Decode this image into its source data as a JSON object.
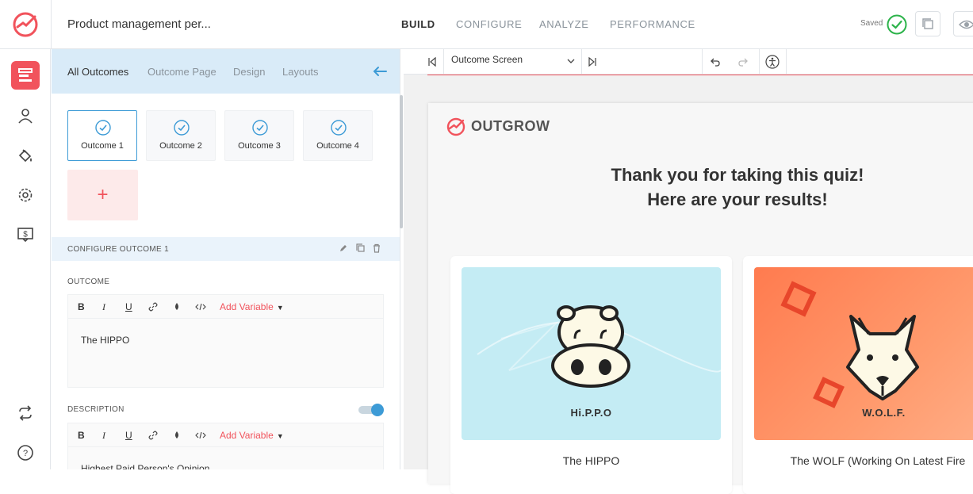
{
  "header": {
    "title": "Product management per...",
    "tabs": [
      "BUILD",
      "CONFIGURE",
      "ANALYZE",
      "PERFORMANCE"
    ],
    "active_tab": "BUILD",
    "saved_label": "Saved"
  },
  "panel": {
    "tabs": [
      "All Outcomes",
      "Outcome Page",
      "Design",
      "Layouts"
    ],
    "active_tab": "All Outcomes",
    "outcomes": [
      "Outcome 1",
      "Outcome 2",
      "Outcome 3",
      "Outcome 4"
    ],
    "add_outcome_label": "+",
    "configure_label": "CONFIGURE OUTCOME 1",
    "outcome_section": "OUTCOME",
    "outcome_value": "The HIPPO",
    "description_section": "DESCRIPTION",
    "description_value": "Highest Paid Person's Opinion",
    "add_variable": "Add Variable",
    "toolbar": {
      "bold": "B",
      "italic": "I",
      "underline": "U"
    }
  },
  "preview": {
    "screen_select": "Outcome Screen",
    "brand": "OUTGROW",
    "heading_line1": "Thank you for taking this quiz!",
    "heading_line2": "Here are your results!",
    "results": [
      {
        "caption": "Hi.P.P.O",
        "title": "The HIPPO"
      },
      {
        "caption": "W.O.L.F.",
        "title": "The WOLF (Working On Latest Fire"
      }
    ]
  },
  "colors": {
    "accent": "#f1535c",
    "primary_blue": "#3d9bd6",
    "success": "#2cb34a",
    "hippo_bg": "#c4ecf4",
    "wolf_bg": "#ff8a5c"
  }
}
